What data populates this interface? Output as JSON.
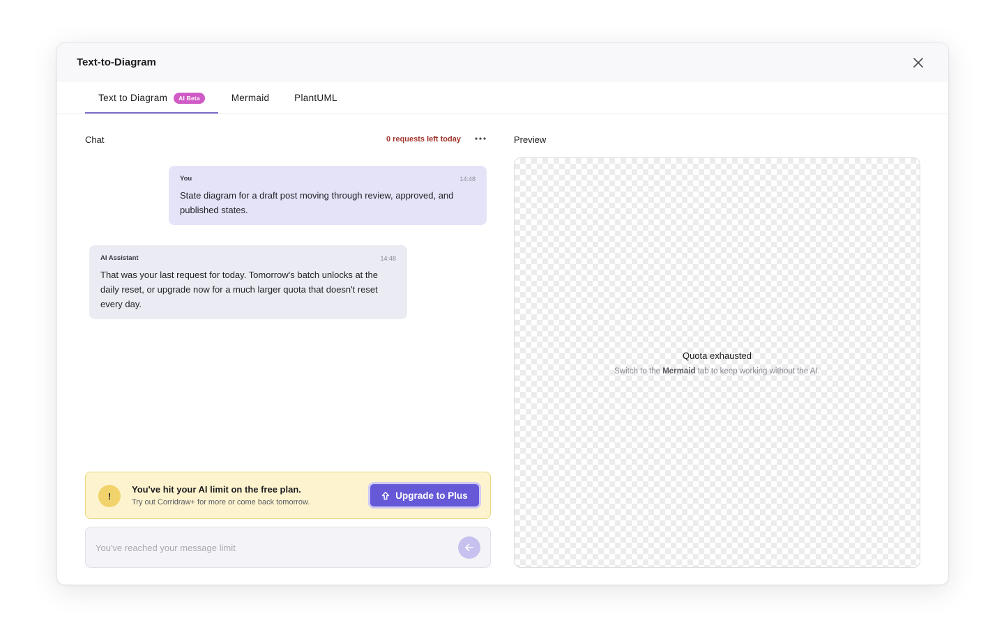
{
  "dialog": {
    "title": "Text-to-Diagram"
  },
  "tabs": [
    {
      "label": "Text to Diagram",
      "badge": "AI Beta",
      "active": true
    },
    {
      "label": "Mermaid",
      "active": false
    },
    {
      "label": "PlantUML",
      "active": false
    }
  ],
  "chat": {
    "label": "Chat",
    "requests_left": "0 requests left today",
    "messages": [
      {
        "author": "You",
        "time": "14:48",
        "text": "State diagram for a draft post moving through review, approved, and published states."
      },
      {
        "author": "AI Assistant",
        "time": "14:48",
        "text": "That was your last request for today. Tomorrow's batch unlocks at the daily reset, or upgrade now for a much larger quota that doesn't reset every day."
      }
    ],
    "limit_banner": {
      "icon_text": "!",
      "title": "You've hit your AI limit on the free plan.",
      "subtitle": "Try out Corridraw+ for more or come back tomorrow.",
      "button_label": "Upgrade to Plus"
    },
    "input": {
      "placeholder": "You've reached your message limit",
      "value": ""
    }
  },
  "preview": {
    "label": "Preview",
    "empty_title": "Quota exhausted",
    "empty_sub_before": "Switch to the",
    "empty_sub_bold": "Mermaid",
    "empty_sub_after": "tab to keep working without the AI."
  },
  "colors": {
    "accent": "#6559d8",
    "tab_indicator": "#7b6dc8",
    "badge": "#cf5bc6",
    "warning_text": "#a1352c",
    "banner_bg": "#fdf4cf"
  },
  "icons": {
    "close": "close-icon",
    "more": "more-dots-icon",
    "upgrade": "arrow-up-icon",
    "send": "arrow-left-icon",
    "warning": "exclamation-icon"
  }
}
